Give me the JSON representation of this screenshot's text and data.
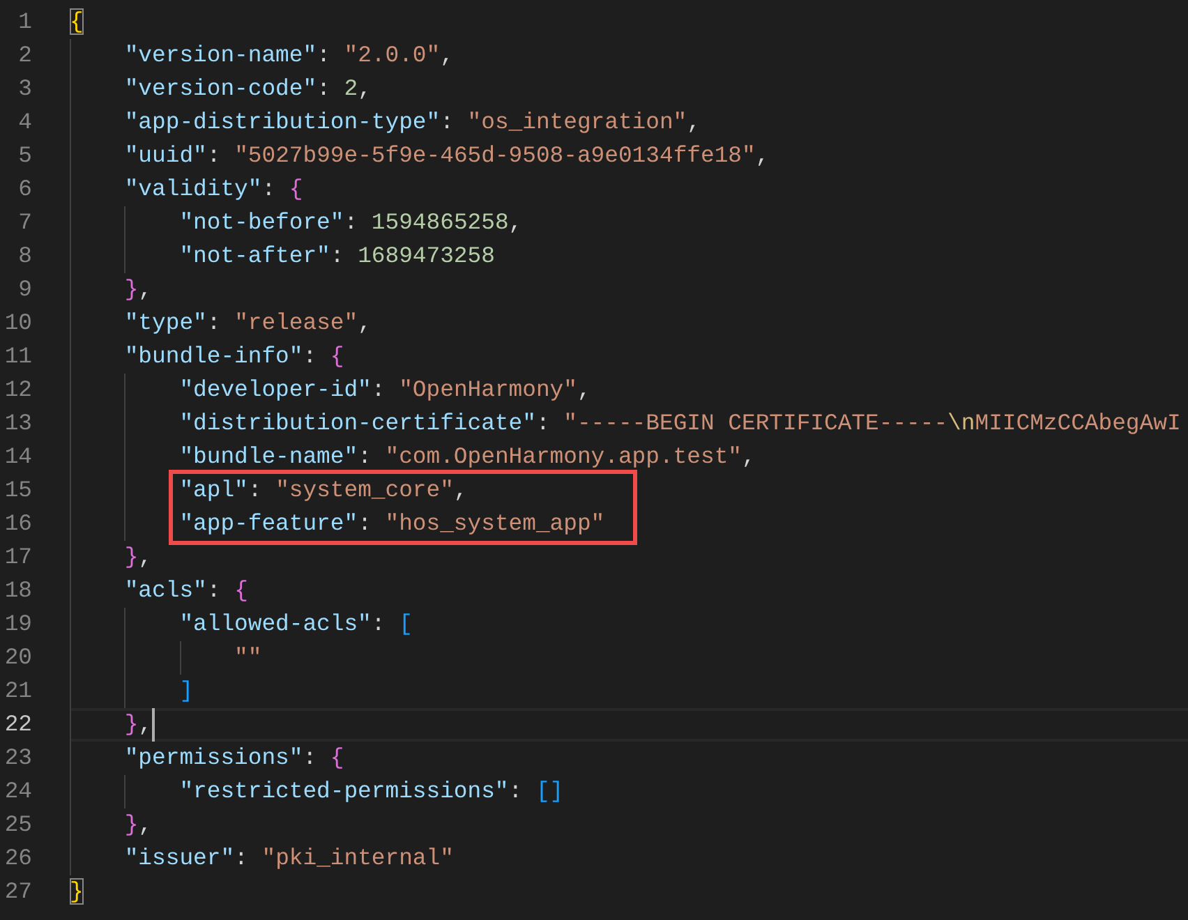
{
  "lines": [
    {
      "number": "1",
      "current": false,
      "marked": false,
      "tokens": [
        {
          "kind": "open",
          "text": "{",
          "matched": true
        }
      ]
    },
    {
      "number": "2",
      "current": false,
      "marked": false,
      "tokens": [
        {
          "kind": "key",
          "text": "\"version-name\""
        },
        {
          "kind": "punct",
          "text": ": "
        },
        {
          "kind": "string",
          "text": "\"2.0.0\""
        },
        {
          "kind": "punct",
          "text": ","
        }
      ]
    },
    {
      "number": "3",
      "current": false,
      "marked": false,
      "tokens": [
        {
          "kind": "key",
          "text": "\"version-code\""
        },
        {
          "kind": "punct",
          "text": ": "
        },
        {
          "kind": "number",
          "text": "2"
        },
        {
          "kind": "punct",
          "text": ","
        }
      ]
    },
    {
      "number": "4",
      "current": false,
      "marked": false,
      "tokens": [
        {
          "kind": "key",
          "text": "\"app-distribution-type\""
        },
        {
          "kind": "punct",
          "text": ": "
        },
        {
          "kind": "string",
          "text": "\"os_integration\""
        },
        {
          "kind": "punct",
          "text": ","
        }
      ]
    },
    {
      "number": "5",
      "current": false,
      "marked": false,
      "tokens": [
        {
          "kind": "key",
          "text": "\"uuid\""
        },
        {
          "kind": "punct",
          "text": ": "
        },
        {
          "kind": "string",
          "text": "\"5027b99e-5f9e-465d-9508-a9e0134ffe18\""
        },
        {
          "kind": "punct",
          "text": ","
        }
      ]
    },
    {
      "number": "6",
      "current": false,
      "marked": false,
      "tokens": [
        {
          "kind": "key",
          "text": "\"validity\""
        },
        {
          "kind": "punct",
          "text": ": "
        },
        {
          "kind": "open",
          "text": "{",
          "matched": false
        }
      ]
    },
    {
      "number": "7",
      "current": false,
      "marked": false,
      "tokens": [
        {
          "kind": "key",
          "text": "\"not-before\""
        },
        {
          "kind": "punct",
          "text": ": "
        },
        {
          "kind": "number",
          "text": "1594865258"
        },
        {
          "kind": "punct",
          "text": ","
        }
      ]
    },
    {
      "number": "8",
      "current": false,
      "marked": false,
      "tokens": [
        {
          "kind": "key",
          "text": "\"not-after\""
        },
        {
          "kind": "punct",
          "text": ": "
        },
        {
          "kind": "number",
          "text": "1689473258"
        }
      ]
    },
    {
      "number": "9",
      "current": false,
      "marked": false,
      "tokens": [
        {
          "kind": "close",
          "text": "}",
          "matched": false
        },
        {
          "kind": "punct",
          "text": ","
        }
      ]
    },
    {
      "number": "10",
      "current": false,
      "marked": false,
      "tokens": [
        {
          "kind": "key",
          "text": "\"type\""
        },
        {
          "kind": "punct",
          "text": ": "
        },
        {
          "kind": "string",
          "text": "\"release\""
        },
        {
          "kind": "punct",
          "text": ","
        }
      ]
    },
    {
      "number": "11",
      "current": false,
      "marked": false,
      "tokens": [
        {
          "kind": "key",
          "text": "\"bundle-info\""
        },
        {
          "kind": "punct",
          "text": ": "
        },
        {
          "kind": "open",
          "text": "{",
          "matched": false
        }
      ]
    },
    {
      "number": "12",
      "current": false,
      "marked": false,
      "tokens": [
        {
          "kind": "key",
          "text": "\"developer-id\""
        },
        {
          "kind": "punct",
          "text": ": "
        },
        {
          "kind": "string",
          "text": "\"OpenHarmony\""
        },
        {
          "kind": "punct",
          "text": ","
        }
      ]
    },
    {
      "number": "13",
      "current": false,
      "marked": false,
      "tokens": [
        {
          "kind": "key",
          "text": "\"distribution-certificate\""
        },
        {
          "kind": "punct",
          "text": ": "
        },
        {
          "kind": "string",
          "text": "\"-----BEGIN CERTIFICATE-----"
        },
        {
          "kind": "escape",
          "text": "\\n"
        },
        {
          "kind": "string",
          "text": "MIICMzCCAbegAwI"
        }
      ]
    },
    {
      "number": "14",
      "current": false,
      "marked": false,
      "tokens": [
        {
          "kind": "key",
          "text": "\"bundle-name\""
        },
        {
          "kind": "punct",
          "text": ": "
        },
        {
          "kind": "string",
          "text": "\"com.OpenHarmony.app.test\""
        },
        {
          "kind": "punct",
          "text": ","
        }
      ]
    },
    {
      "number": "15",
      "current": false,
      "marked": true,
      "tokens": [
        {
          "kind": "key",
          "text": "\"apl\""
        },
        {
          "kind": "punct",
          "text": ": "
        },
        {
          "kind": "string",
          "text": "\"system_core\""
        },
        {
          "kind": "punct",
          "text": ","
        }
      ]
    },
    {
      "number": "16",
      "current": false,
      "marked": true,
      "tokens": [
        {
          "kind": "key",
          "text": "\"app-feature\""
        },
        {
          "kind": "punct",
          "text": ": "
        },
        {
          "kind": "string",
          "text": "\"hos_system_app\""
        }
      ]
    },
    {
      "number": "17",
      "current": false,
      "marked": false,
      "tokens": [
        {
          "kind": "close",
          "text": "}",
          "matched": false
        },
        {
          "kind": "punct",
          "text": ","
        }
      ]
    },
    {
      "number": "18",
      "current": false,
      "marked": false,
      "tokens": [
        {
          "kind": "key",
          "text": "\"acls\""
        },
        {
          "kind": "punct",
          "text": ": "
        },
        {
          "kind": "open",
          "text": "{",
          "matched": false
        }
      ]
    },
    {
      "number": "19",
      "current": false,
      "marked": false,
      "tokens": [
        {
          "kind": "key",
          "text": "\"allowed-acls\""
        },
        {
          "kind": "punct",
          "text": ": "
        },
        {
          "kind": "open",
          "text": "[",
          "matched": false
        }
      ]
    },
    {
      "number": "20",
      "current": false,
      "marked": false,
      "tokens": [
        {
          "kind": "string",
          "text": "\"\""
        }
      ]
    },
    {
      "number": "21",
      "current": false,
      "marked": false,
      "tokens": [
        {
          "kind": "close",
          "text": "]",
          "matched": false
        }
      ]
    },
    {
      "number": "22",
      "current": true,
      "marked": false,
      "tokens": [
        {
          "kind": "close",
          "text": "}",
          "matched": false
        },
        {
          "kind": "punct",
          "text": ","
        }
      ]
    },
    {
      "number": "23",
      "current": false,
      "marked": false,
      "tokens": [
        {
          "kind": "key",
          "text": "\"permissions\""
        },
        {
          "kind": "punct",
          "text": ": "
        },
        {
          "kind": "open",
          "text": "{",
          "matched": false
        }
      ]
    },
    {
      "number": "24",
      "current": false,
      "marked": false,
      "tokens": [
        {
          "kind": "key",
          "text": "\"restricted-permissions\""
        },
        {
          "kind": "punct",
          "text": ": "
        },
        {
          "kind": "open",
          "text": "[",
          "matched": false
        },
        {
          "kind": "close",
          "text": "]",
          "matched": false
        }
      ]
    },
    {
      "number": "25",
      "current": false,
      "marked": false,
      "tokens": [
        {
          "kind": "close",
          "text": "}",
          "matched": false
        },
        {
          "kind": "punct",
          "text": ","
        }
      ]
    },
    {
      "number": "26",
      "current": false,
      "marked": false,
      "tokens": [
        {
          "kind": "key",
          "text": "\"issuer\""
        },
        {
          "kind": "punct",
          "text": ": "
        },
        {
          "kind": "string",
          "text": "\"pki_internal\""
        }
      ]
    },
    {
      "number": "27",
      "current": false,
      "marked": false,
      "tokens": [
        {
          "kind": "close",
          "text": "}",
          "matched": true
        }
      ]
    }
  ]
}
